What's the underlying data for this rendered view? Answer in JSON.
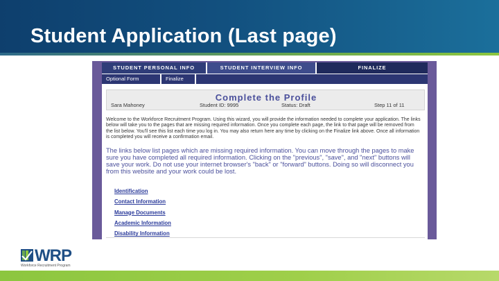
{
  "slide": {
    "title": "Student Application (Last page)"
  },
  "logo": {
    "text": "WRP",
    "tagline": "Workforce Recruitment Program"
  },
  "app": {
    "main_tabs": [
      "STUDENT PERSONAL INFO",
      "STUDENT INTERVIEW INFO",
      "FINALIZE"
    ],
    "sub_tabs": [
      "Optional Form",
      "Finalize"
    ],
    "profile": {
      "title": "Complete the Profile",
      "name": "Sara Mahoney",
      "student_id": "Student ID: 9995",
      "status": "Status: Draft",
      "step": "Step 11 of 11"
    },
    "welcome_text": "Welcome to the Workforce Recruitment Program. Using this wizard, you will provide the information needed to complete your application. The links below will take you to the pages that are missing required information. Once you complete each page, the link to that page will be removed from the list below. You'll see this list each time you log in. You may also return here any time by clicking on the Finalize link above. Once all information is completed you will receive a confirmation email.",
    "notice_text": "The links below list pages which are missing required information. You can move through the pages to make sure you have completed all required information. Clicking on the \"previous\", \"save\", and \"next\" buttons will save your work. Do not use your internet browser's \"back\" or \"forward\" buttons. Doing so will disconnect you from this website and your work could be lost.",
    "links": [
      "Identification",
      "Contact Information",
      "Manage Documents",
      "Academic Information",
      "Disability Information"
    ]
  },
  "colors": {
    "header_blue": "#12507f",
    "accent_green": "#8cc63f",
    "frame_purple": "#6a5a9a",
    "tab_navy": "#2f3d79",
    "heading_purple": "#4a4f9b",
    "link_blue": "#2a3a9a"
  }
}
